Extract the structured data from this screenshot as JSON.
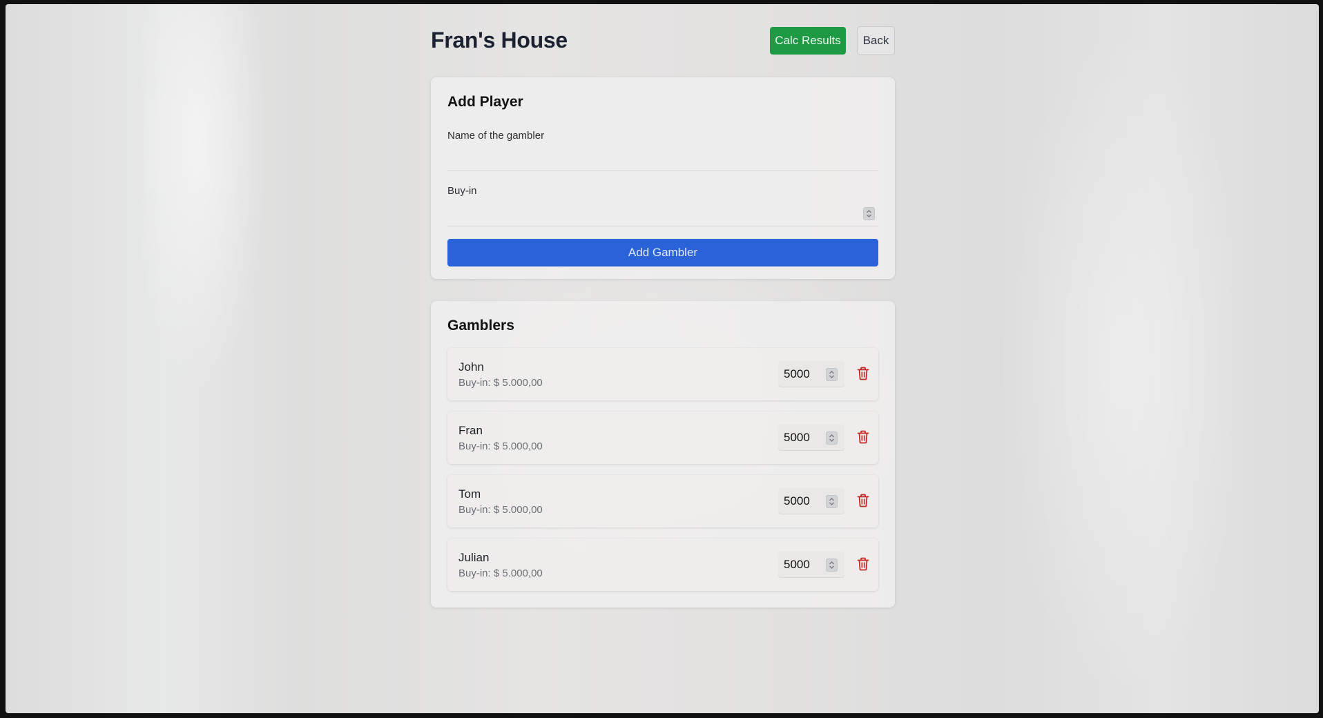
{
  "header": {
    "title": "Fran's House",
    "calc_label": "Calc Results",
    "back_label": "Back"
  },
  "add_player": {
    "title": "Add Player",
    "name_label": "Name of the gambler",
    "name_value": "",
    "buyin_label": "Buy-in",
    "buyin_value": "",
    "add_button_label": "Add Gambler"
  },
  "gamblers": {
    "title": "Gamblers",
    "players": [
      {
        "name": "John",
        "buyin_text": "Buy-in: $ 5.000,00",
        "amount": "5000"
      },
      {
        "name": "Fran",
        "buyin_text": "Buy-in: $ 5.000,00",
        "amount": "5000"
      },
      {
        "name": "Tom",
        "buyin_text": "Buy-in: $ 5.000,00",
        "amount": "5000"
      },
      {
        "name": "Julian",
        "buyin_text": "Buy-in: $ 5.000,00",
        "amount": "5000"
      }
    ]
  },
  "icons": {
    "delete": "trash-icon",
    "stepper": "up-down-chevron-icon"
  },
  "colors": {
    "calc_button": "#1e9a45",
    "add_button": "#2962d9",
    "delete_icon": "#c62828"
  }
}
